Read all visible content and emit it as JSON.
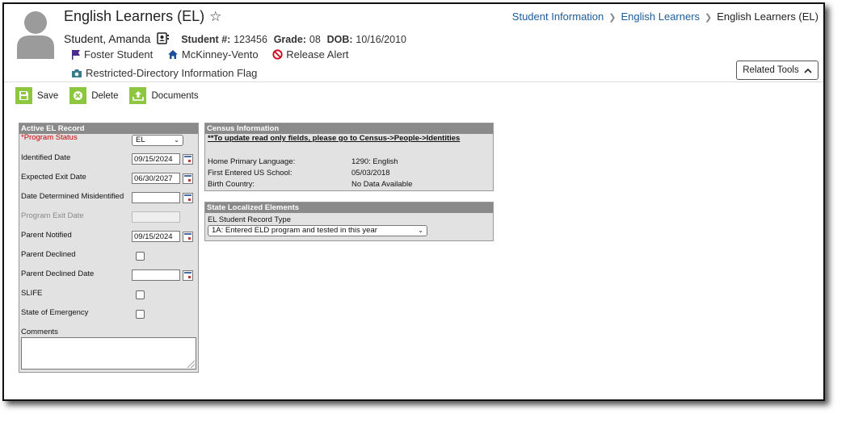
{
  "header": {
    "title": "English Learners (EL)",
    "breadcrumb": [
      "Student Information",
      "English Learners",
      "English Learners (EL)"
    ],
    "student_name": "Student, Amanda",
    "student_num_label": "Student #:",
    "student_num": "123456",
    "grade_label": "Grade:",
    "grade": "08",
    "dob_label": "DOB:",
    "dob": "10/16/2010",
    "flags": [
      "Foster Student",
      "McKinney-Vento",
      "Release Alert"
    ],
    "flag_restricted": "Restricted-Directory Information Flag",
    "related_tools": "Related Tools"
  },
  "toolbar": {
    "save": "Save",
    "delete": "Delete",
    "documents": "Documents"
  },
  "el_record": {
    "title": "Active EL Record",
    "program_status_label": "*Program Status",
    "program_status": "EL",
    "identified_date_label": "Identified Date",
    "identified_date": "09/15/2024",
    "expected_exit_label": "Expected Exit Date",
    "expected_exit": "06/30/2027",
    "misidentified_label": "Date Determined Misidentified",
    "misidentified": "",
    "program_exit_label": "Program Exit Date",
    "parent_notified_label": "Parent Notified",
    "parent_notified": "09/15/2024",
    "parent_declined_label": "Parent Declined",
    "parent_declined_date_label": "Parent Declined Date",
    "slife_label": "SLIFE",
    "emergency_label": "State of Emergency",
    "comments_label": "Comments"
  },
  "census": {
    "title": "Census Information",
    "note": "**To update read only fields, please go to Census->People->Identities",
    "rows": [
      {
        "label": "Home Primary Language:",
        "value": "1290: English"
      },
      {
        "label": "First Entered US School:",
        "value": "05/03/2018"
      },
      {
        "label": "Birth Country:",
        "value": "No Data Available"
      }
    ]
  },
  "state": {
    "title": "State Localized Elements",
    "record_type_label": "EL Student Record Type",
    "record_type": "1A: Entered ELD program and tested in this year"
  },
  "colors": {
    "accent": "#8dc63f",
    "link": "#1e5c9a",
    "panel_header": "#8a8a8a",
    "required": "#cc0000"
  }
}
